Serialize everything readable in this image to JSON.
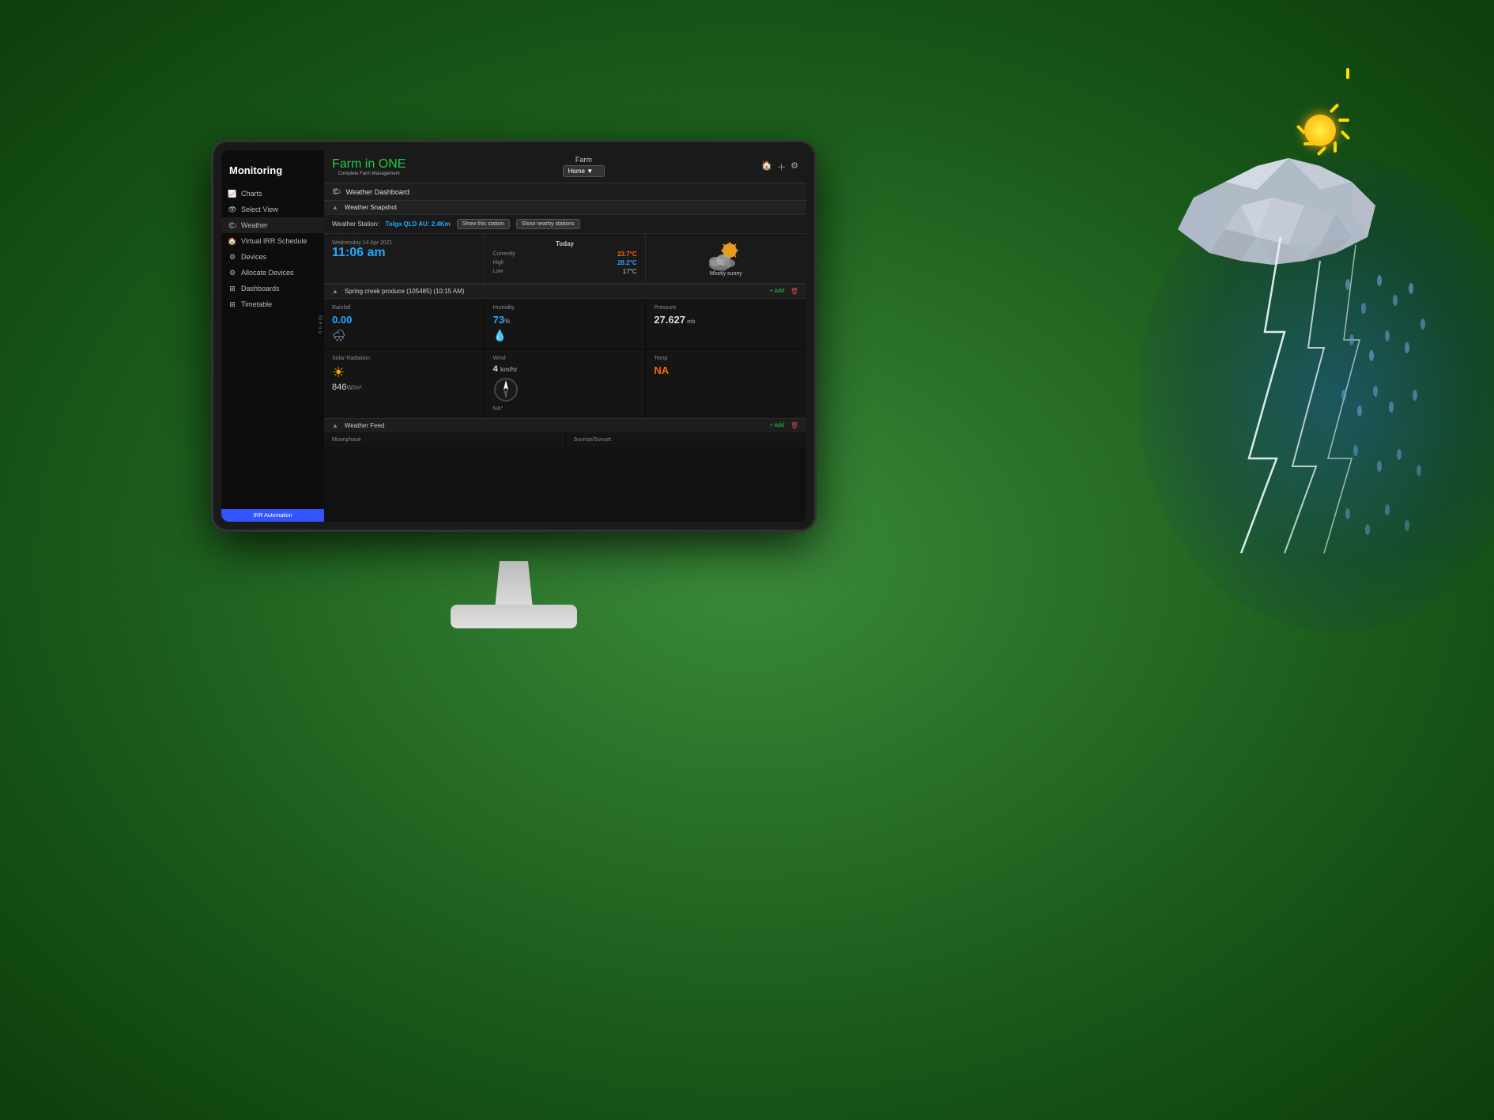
{
  "app": {
    "title": "Monitoring"
  },
  "logo": {
    "farm": "Farm",
    "in": " in ",
    "one": "ONE",
    "subtitle": "Complete Farm Management"
  },
  "topbar": {
    "farm_label": "Farm",
    "home_dropdown": "Home",
    "icons": [
      "home-icon",
      "plus-icon",
      "gear-icon"
    ]
  },
  "sidebar": {
    "title": "Monitoring",
    "items": [
      {
        "id": "charts",
        "label": "Charts"
      },
      {
        "id": "select-view",
        "label": "Select View"
      },
      {
        "id": "weather",
        "label": "Weather"
      },
      {
        "id": "virtual-irr",
        "label": "Virtual IRR Schedule"
      },
      {
        "id": "devices",
        "label": "Devices"
      },
      {
        "id": "allocate-devices",
        "label": "Allocate Devices"
      },
      {
        "id": "dashboards",
        "label": "Dashboards"
      },
      {
        "id": "timetable",
        "label": "Timetable"
      }
    ],
    "menu_label": "M\ne\nn\nu",
    "irr_bar": "IRR Automation"
  },
  "weather_dashboard": {
    "panel_title": "Weather Dashboard",
    "snapshot_title": "Weather Snapshot",
    "station_label": "Weather Station:",
    "station_name": "Tolga QLD AU: 2.4Km",
    "btn_show_station": "Show this station",
    "btn_show_nearby": "Show nearby stations",
    "today": {
      "header": "Today",
      "date": "Wednesday 14 Apr 2021",
      "time": "11:06 am",
      "currently_label": "Currently",
      "currently_val": "23.7°C",
      "high_label": "High",
      "high_val": "28.2°C",
      "low_label": "Low",
      "low_val": "17°C",
      "condition": "Mostly sunny"
    },
    "sensor_section": {
      "title": "Spring creek produce (105485) (10:15 AM)",
      "add_label": "+ Add",
      "cards": [
        {
          "label": "Rainfall",
          "value": "0.00",
          "unit": "",
          "icon": "cloud-rain"
        },
        {
          "label": "Humidity",
          "value": "73",
          "unit": "%",
          "icon": "droplet"
        },
        {
          "label": "Pressure",
          "value": "27.627",
          "unit": "mb",
          "icon": ""
        },
        {
          "label": "Solar Radiation",
          "value": "846",
          "unit": "W/m²",
          "icon": "sun"
        },
        {
          "label": "Wind",
          "value": "4",
          "unit": "km/hr",
          "direction": "NA°",
          "icon": "compass"
        },
        {
          "label": "Temp",
          "value": "NA",
          "unit": "",
          "icon": ""
        }
      ]
    },
    "weather_feed": {
      "title": "Weather Feed",
      "add_label": "+ Add",
      "cards": [
        {
          "label": "Moonphase"
        },
        {
          "label": "Sunrise/Sunset"
        }
      ]
    }
  },
  "colors": {
    "blue_accent": "#22aaff",
    "orange_accent": "#ff6600",
    "green_accent": "#22cc44",
    "red_accent": "#cc4444",
    "bg_dark": "#111111",
    "bg_panel": "#1a1a1a",
    "border": "#2a2a2a"
  }
}
